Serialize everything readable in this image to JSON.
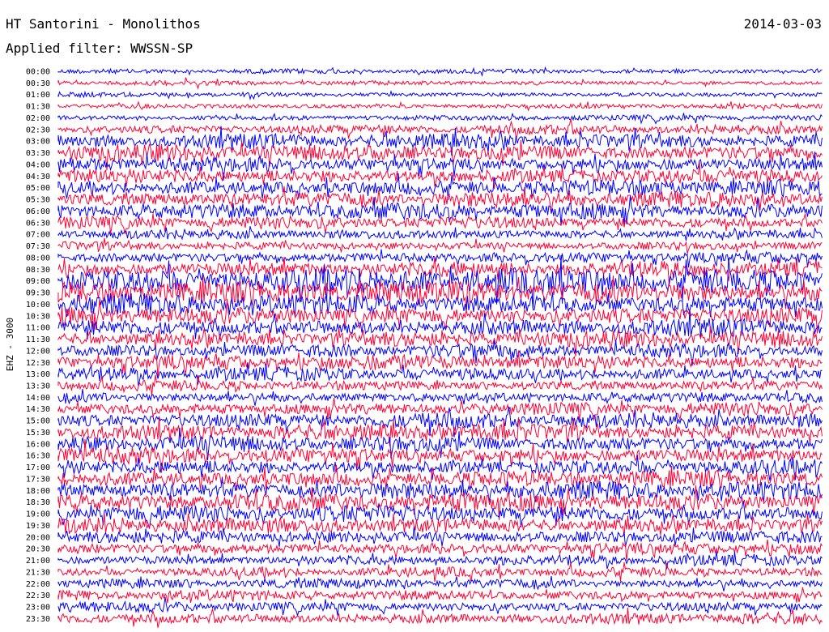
{
  "header": {
    "station": "HT Santorini - Monolithos",
    "date": "2014-03-03",
    "filter_label": "Applied filter: WWSSN-SP"
  },
  "chart_data": {
    "type": "line",
    "subtype": "helicorder",
    "channel_label": "EHZ - 3000",
    "trace_colors": [
      "#0000ff",
      "#ff0033"
    ],
    "line_times": [
      "00:00",
      "00:30",
      "01:00",
      "01:30",
      "02:00",
      "02:30",
      "03:00",
      "03:30",
      "04:00",
      "04:30",
      "05:00",
      "05:30",
      "06:00",
      "06:30",
      "07:00",
      "07:30",
      "08:00",
      "08:30",
      "09:00",
      "09:30",
      "10:00",
      "10:30",
      "11:00",
      "11:30",
      "12:00",
      "12:30",
      "13:00",
      "13:30",
      "14:00",
      "14:30",
      "15:00",
      "15:30",
      "16:00",
      "16:30",
      "17:00",
      "17:30",
      "18:00",
      "18:30",
      "19:00",
      "19:30",
      "20:00",
      "20:30",
      "21:00",
      "21:30",
      "22:00",
      "22:30",
      "23:00",
      "23:30"
    ],
    "relative_amplitude": [
      0.45,
      0.45,
      0.5,
      0.5,
      0.55,
      0.9,
      1.4,
      1.6,
      1.5,
      1.6,
      1.6,
      1.5,
      1.5,
      1.2,
      1.0,
      0.9,
      1.1,
      1.5,
      2.4,
      2.2,
      2.0,
      1.9,
      1.8,
      1.6,
      1.3,
      1.4,
      1.3,
      1.1,
      1.1,
      1.3,
      1.5,
      1.5,
      1.5,
      1.6,
      1.6,
      1.7,
      1.7,
      1.7,
      1.6,
      1.6,
      1.4,
      1.2,
      1.0,
      0.9,
      0.9,
      1.0,
      1.1,
      1.2
    ]
  }
}
